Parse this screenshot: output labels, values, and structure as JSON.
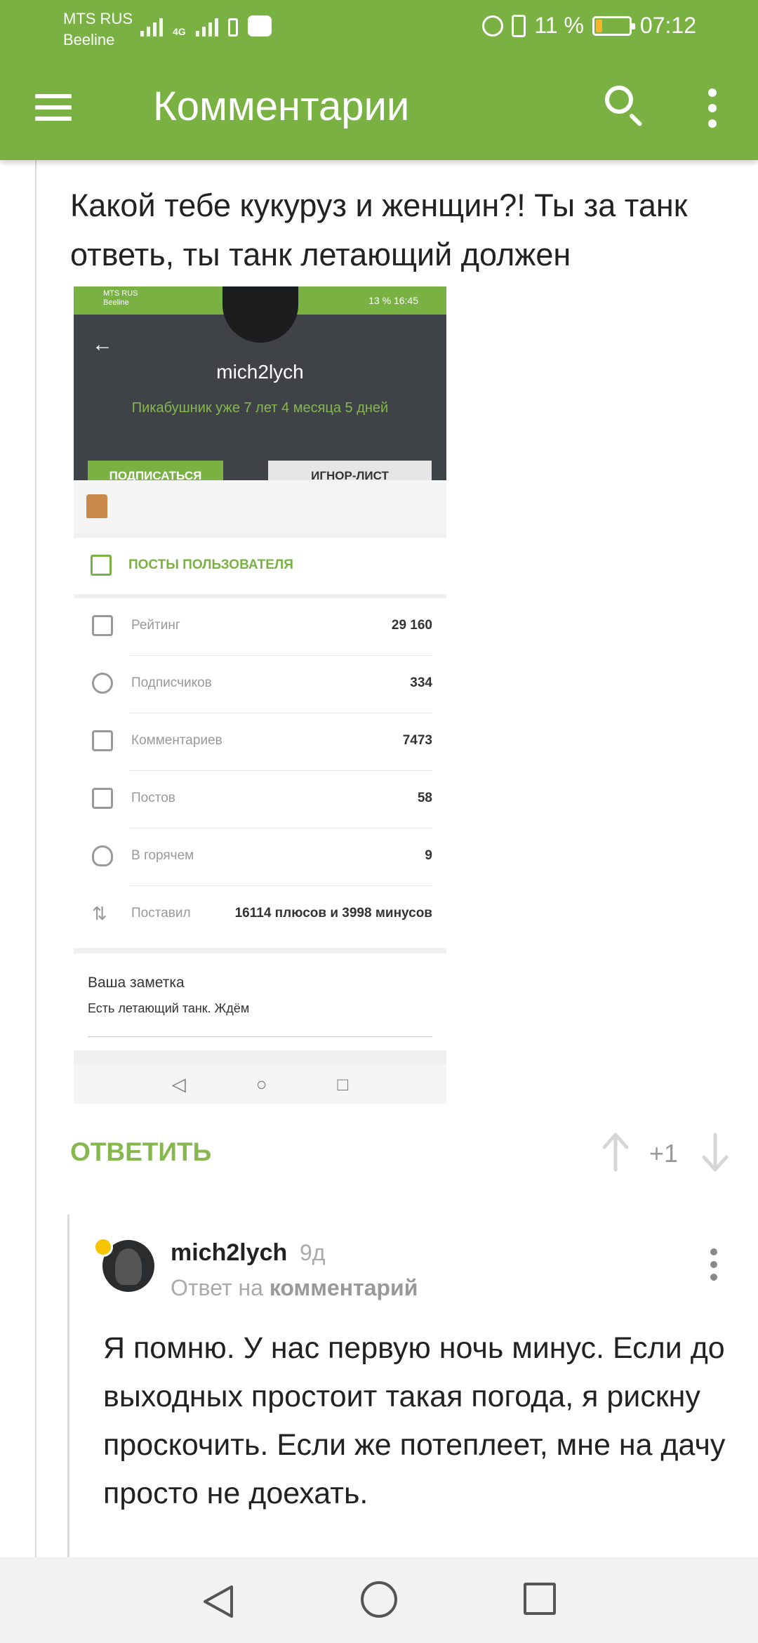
{
  "status_bar": {
    "carrier1": "MTS RUS",
    "carrier2": "Beeline",
    "network": "4G",
    "battery_percent": "11 %",
    "time": "07:12",
    "battery_color": "#ffb12a"
  },
  "app_bar": {
    "title": "Комментарии",
    "menu_icon": "hamburger-menu-icon",
    "search_icon": "search-icon",
    "more_icon": "more-vertical-icon",
    "color": "#79b243"
  },
  "comment": {
    "text": "Какой тебе кукуруз и женщин?! Ты за танк ответь, ты танк летающий должен"
  },
  "embedded_screenshot": {
    "status_carrier1": "MTS RUS",
    "status_carrier2": "Beeline",
    "status_right": "13 %    16:45",
    "username": "mich2lych",
    "tenure": "Пикабушник уже 7 лет 4 месяца 5 дней",
    "subscribe_label": "ПОДПИСАТЬСЯ",
    "ignore_label": "ИГНОР-ЛИСТ",
    "posts_label": "ПОСТЫ ПОЛЬЗОВАТЕЛЯ",
    "stats": [
      {
        "label": "Рейтинг",
        "value": "29 160"
      },
      {
        "label": "Подписчиков",
        "value": "334"
      },
      {
        "label": "Комментариев",
        "value": "7473"
      },
      {
        "label": "Постов",
        "value": "58"
      },
      {
        "label": "В горячем",
        "value": "9"
      },
      {
        "label": "Поставил",
        "value": "16114 плюсов и 3998 минусов"
      }
    ],
    "note_title": "Ваша заметка",
    "note_text": "Есть летающий танк. Ждём",
    "nav_back": "◁",
    "nav_home": "○",
    "nav_recent": "□"
  },
  "actions": {
    "reply_label": "ОТВЕТИТЬ",
    "score": "+1",
    "accent_color": "#86b84f"
  },
  "reply_comment": {
    "author": "mich2lych",
    "time": "9д",
    "meta_prefix": "Ответ на",
    "meta_link": "комментарий",
    "text": "Я помню. У нас первую ночь минус. Если до выходных простоит такая погода, я рискну проскочить. Если же потеплеет, мне на дачу просто не доехать."
  }
}
